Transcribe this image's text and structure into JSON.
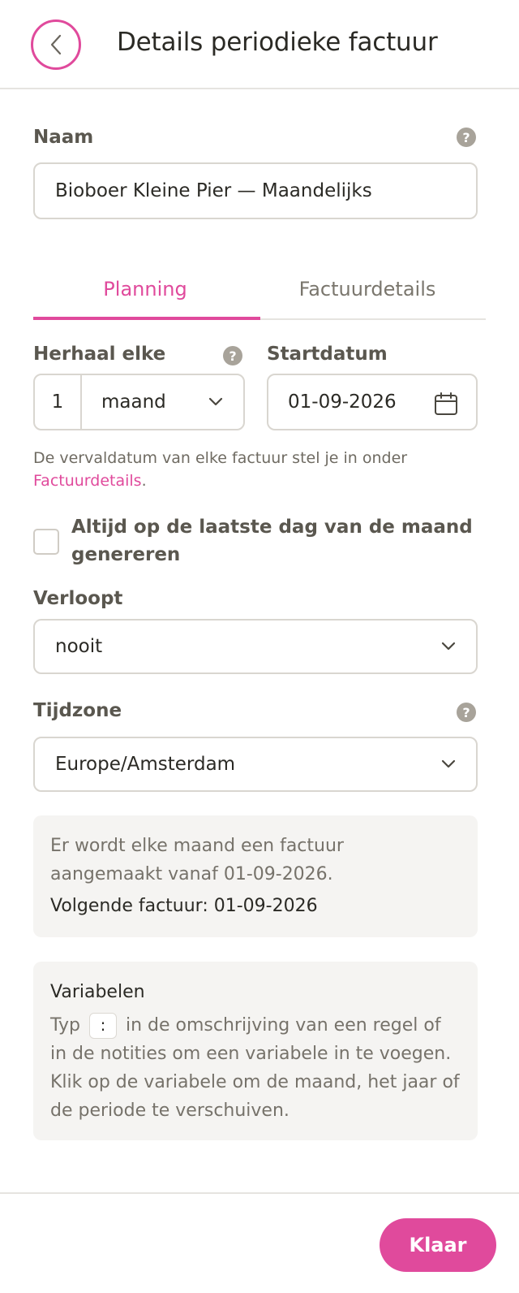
{
  "header": {
    "title": "Details periodieke factuur"
  },
  "name": {
    "label": "Naam",
    "value": "Bioboer Kleine Pier — Maandelijks"
  },
  "tabs": [
    {
      "label": "Planning",
      "active": true
    },
    {
      "label": "Factuurdetails",
      "active": false
    }
  ],
  "repeat": {
    "label": "Herhaal elke",
    "number": "1",
    "unit": "maand"
  },
  "start": {
    "label": "Startdatum",
    "value": "01-09-2026"
  },
  "hint": {
    "text": "De vervaldatum van elke factuur stel je in onder ",
    "link": "Factuurdetails",
    "suffix": "."
  },
  "last_day": {
    "label": "Altijd op de laatste dag van de maand genereren",
    "checked": false
  },
  "expires": {
    "label": "Verloopt",
    "value": "nooit"
  },
  "timezone": {
    "label": "Tijdzone",
    "value": "Europe/Amsterdam"
  },
  "summary": {
    "text": "Er wordt elke maand een factuur aangemaakt vanaf 01-09-2026.",
    "next": "Volgende factuur: 01-09-2026"
  },
  "variables": {
    "title": "Variabelen",
    "text_before": "Typ",
    "key": ":",
    "text_after": "in de omschrijving van een regel of in de notities om een variabele in te voegen. Klik op de variabele om de maand, het jaar of de periode te verschuiven."
  },
  "footer": {
    "done_label": "Klaar"
  },
  "colors": {
    "accent": "#e04a9c",
    "border": "#d9d6d0",
    "panel": "#f5f4f2"
  }
}
